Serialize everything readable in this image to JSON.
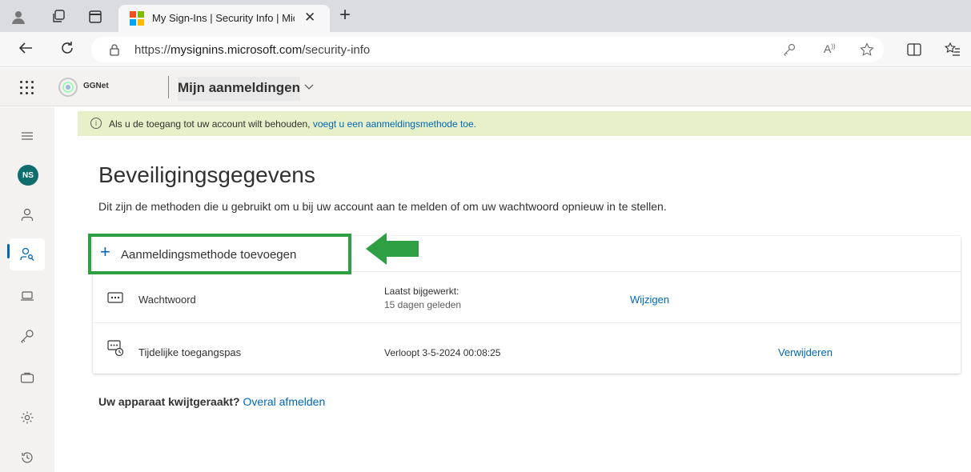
{
  "browser": {
    "tab_title": "My Sign-Ins | Security Info | Micros",
    "tab_close": "✕",
    "new_tab": "+",
    "url_prefix": "https://",
    "url_host": "mysignins.microsoft.com",
    "url_path": "/security-info"
  },
  "header": {
    "org_name": "GGNet",
    "app_title": "Mijn aanmeldingen"
  },
  "rail": {
    "avatar_initials": "NS"
  },
  "banner": {
    "text": "Als u de toegang tot uw account wilt behouden, ",
    "link": "voegt u een aanmeldingsmethode toe."
  },
  "main": {
    "title": "Beveiligingsgegevens",
    "subtitle": "Dit zijn de methoden die u gebruikt om u bij uw account aan te melden of om uw wachtwoord opnieuw in te stellen.",
    "add_method_label": "Aanmeldingsmethode toevoegen",
    "methods": [
      {
        "icon": "password-dots-icon",
        "name": "Wachtwoord",
        "detail_line1": "Laatst bijgewerkt:",
        "detail_line2": "15 dagen geleden",
        "action": "Wijzigen"
      },
      {
        "icon": "temporary-access-pass-icon",
        "name": "Tijdelijke toegangspas",
        "detail_line1": "Verloopt 3-5-2024 00:08:25",
        "action": "Verwijderen"
      }
    ],
    "lost_device_text": "Uw apparaat kwijtgeraakt?",
    "lost_device_link": "Overal afmelden"
  },
  "colors": {
    "accent": "#0067b8",
    "highlight": "#2ea043",
    "banner_bg": "#e7f0c8"
  }
}
